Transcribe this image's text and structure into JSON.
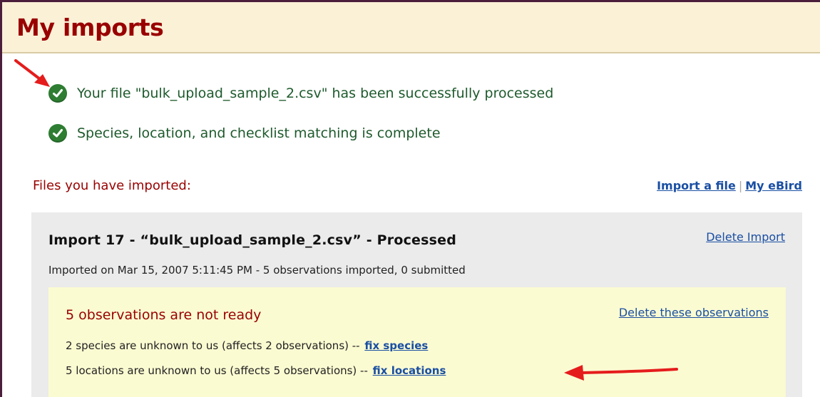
{
  "header": {
    "title": "My imports"
  },
  "status_messages": [
    {
      "text": "Your file \"bulk_upload_sample_2.csv\" has been successfully processed",
      "icon": "check-circle-icon"
    },
    {
      "text": "Species, location, and checklist matching is complete",
      "icon": "check-circle-icon"
    }
  ],
  "files_section": {
    "heading": "Files you have imported:",
    "links": {
      "import_file": "Import a file",
      "separator": "|",
      "my_ebird": "My eBird"
    }
  },
  "import": {
    "title": "Import 17 - “bulk_upload_sample_2.csv” - Processed",
    "delete_label": "Delete Import",
    "meta": "Imported on Mar 15, 2007 5:11:45 PM - 5 observations imported, 0 submitted",
    "not_ready": {
      "heading": "5 observations are not ready",
      "delete_label": "Delete these observations",
      "issues": [
        {
          "text": "2 species are unknown to us (affects 2 observations) --",
          "link": "fix species"
        },
        {
          "text": "5 locations are unknown to us (affects 5 observations) --",
          "link": "fix locations"
        }
      ]
    }
  },
  "colors": {
    "title_red": "#990000",
    "success_green": "#2e7d32",
    "link_blue": "#1a4fa3",
    "header_bg": "#fbf1d7",
    "panel_gray": "#ebebeb",
    "notice_yellow": "#fbfbd2",
    "annotation_arrow": "#e51c1c"
  }
}
